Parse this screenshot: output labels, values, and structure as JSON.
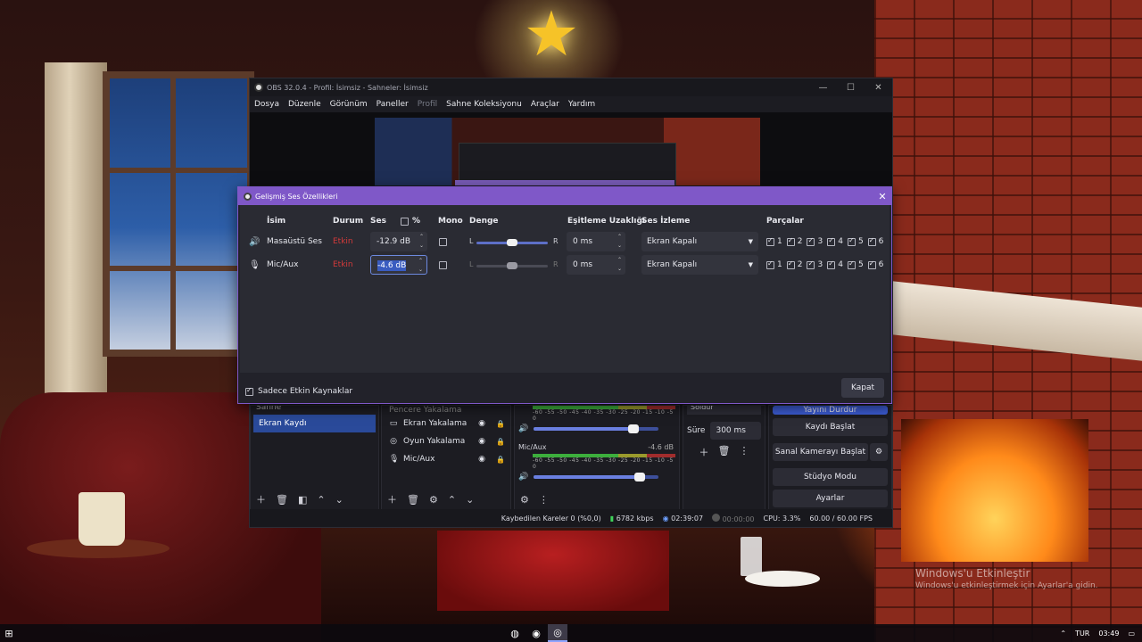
{
  "main_window": {
    "title": "OBS 32.0.4 - Profil: İsimsiz - Sahneler: İsimsiz",
    "menu": [
      "Dosya",
      "Düzenle",
      "Görünüm",
      "Paneller",
      "Profil",
      "Sahne Koleksiyonu",
      "Araçlar",
      "Yardım"
    ],
    "minimize": "—",
    "maximize": "☐",
    "close": "✕"
  },
  "scenes": {
    "partial": "Sahne",
    "selected": "Ekran Kaydı"
  },
  "sources": {
    "items": [
      {
        "icon": "monitor-icon",
        "label": "Ekran Yakalama"
      },
      {
        "icon": "gamepad-icon",
        "label": "Oyun Yakalama"
      },
      {
        "icon": "microphone-icon",
        "label": "Mic/Aux"
      }
    ],
    "partial": "Pencere Yakalama"
  },
  "mixer": {
    "ticks": "-60 -55 -50 -45 -40 -35 -30 -25 -20 -15 -10 -5 0",
    "channels": [
      {
        "name": "",
        "db": "",
        "volume_fraction": 0.8
      },
      {
        "name": "Mic/Aux",
        "db": "-4.6 dB",
        "volume_fraction": 0.85
      }
    ]
  },
  "transitions": {
    "selected": "Solduř",
    "duration_label": "Süre",
    "duration_value": "300 ms"
  },
  "controls": {
    "stream": "Yayını Durdur",
    "record": "Kaydı Başlat",
    "virtual_cam": "Sanal Kamerayı Başlat",
    "studio": "Stüdyo Modu",
    "settings": "Ayarlar"
  },
  "status_bar": {
    "dropped": "Kaybedilen Kareler 0 (%0,0)",
    "bitrate": "6782 kbps",
    "stream_time": "02:39:07",
    "rec_time": "00:00:00",
    "cpu": "CPU: 3.3%",
    "fps": "60.00 / 60.00 FPS"
  },
  "dialog": {
    "title": "Gelişmiş Ses Özellikleri",
    "headers": {
      "name": "İsim",
      "status": "Durum",
      "volume": "Ses",
      "percent": "%",
      "mono": "Mono",
      "balance": "Denge",
      "sync_offset": "Eşitleme Uzaklığı",
      "monitoring": "Ses İzleme",
      "tracks": "Parçalar"
    },
    "rows": [
      {
        "name": "Masaüstü Ses",
        "status": "Etkin",
        "volume": "-12.9 dB",
        "balance_left": "L",
        "balance_right": "R",
        "sync": "0 ms",
        "monitoring": "Ekran Kapalı"
      },
      {
        "name": "Mic/Aux",
        "status": "Etkin",
        "volume": "-4.6 dB",
        "balance_left": "L",
        "balance_right": "R",
        "sync": "0 ms",
        "monitoring": "Ekran Kapalı"
      }
    ],
    "track_numbers": [
      "1",
      "2",
      "3",
      "4",
      "5",
      "6"
    ],
    "active_only_label": "Sadece Etkin Kaynaklar",
    "close_button": "Kapat"
  },
  "watermark": {
    "line1": "Windows'u Etkinleştir",
    "line2": "Windows'u etkinleştirmek için Ayarlar'a gidin."
  },
  "taskbar": {
    "lang": "TUR",
    "time": "03:49"
  },
  "colors": {
    "accent": "#7f58c8",
    "selection": "#2a4a9a",
    "muted_status": "#d33a3a"
  }
}
